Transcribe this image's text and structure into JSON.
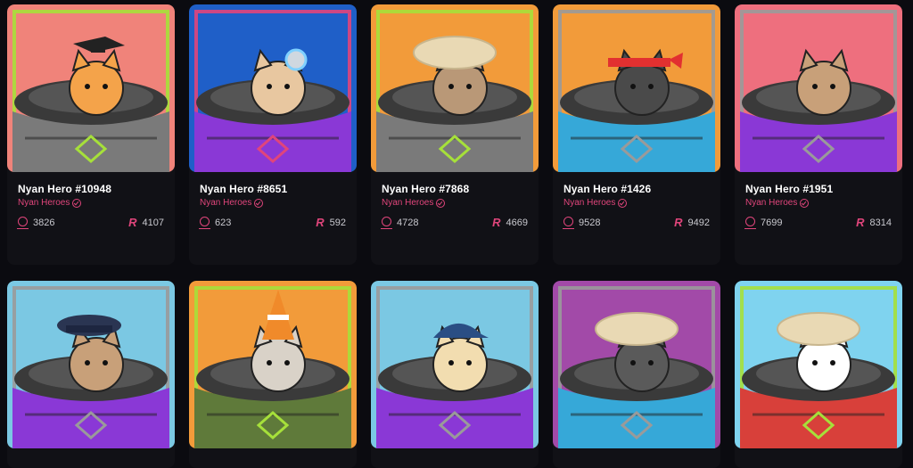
{
  "cards": [
    {
      "name": "Nyan Hero #10948",
      "collection": "Nyan Heroes",
      "left_value": "3826",
      "right_value": "4107",
      "bg": "#f0837a",
      "vehicle": "#7a7a7a",
      "frame": "#a6e03a",
      "fur": "#f4a34a",
      "hat": "grad-cap"
    },
    {
      "name": "Nyan Hero #8651",
      "collection": "Nyan Heroes",
      "left_value": "623",
      "right_value": "592",
      "bg": "#1f5fc8",
      "vehicle": "#8a38d6",
      "frame": "#e0457b",
      "fur": "#e8c7a0",
      "hat": "headphones"
    },
    {
      "name": "Nyan Hero #7868",
      "collection": "Nyan Heroes",
      "left_value": "4728",
      "right_value": "4669",
      "bg": "#f29b3a",
      "vehicle": "#7a7a7a",
      "frame": "#a6e03a",
      "fur": "#b99877",
      "hat": "straw-hat"
    },
    {
      "name": "Nyan Hero #1426",
      "collection": "Nyan Heroes",
      "left_value": "9528",
      "right_value": "9492",
      "bg": "#f29b3a",
      "vehicle": "#36a8d8",
      "frame": "#9a9a9a",
      "fur": "#4a4a4a",
      "hat": "bandana"
    },
    {
      "name": "Nyan Hero #1951",
      "collection": "Nyan Heroes",
      "left_value": "7699",
      "right_value": "8314",
      "bg": "#ee6f7e",
      "vehicle": "#8a38d6",
      "frame": "#9a9a9a",
      "fur": "#c8a079",
      "hat": "none"
    },
    {
      "bg": "#7bc8e3",
      "vehicle": "#8a38d6",
      "frame": "#9a9a9a",
      "fur": "#c8a079",
      "hat": "police-cap"
    },
    {
      "bg": "#f29b3a",
      "vehicle": "#5f7a3a",
      "frame": "#a6e03a",
      "fur": "#d9d2c8",
      "hat": "cone"
    },
    {
      "bg": "#7bc8e3",
      "vehicle": "#8a38d6",
      "frame": "#9a9a9a",
      "fur": "#f2ddb0",
      "hat": "cap"
    },
    {
      "bg": "#a24aa8",
      "vehicle": "#36a8d8",
      "frame": "#9a9a9a",
      "fur": "#5a5a5a",
      "hat": "straw-hat"
    },
    {
      "bg": "#7fd3ef",
      "vehicle": "#d8403a",
      "frame": "#a6e03a",
      "fur": "#ffffff",
      "hat": "straw-hat"
    }
  ]
}
